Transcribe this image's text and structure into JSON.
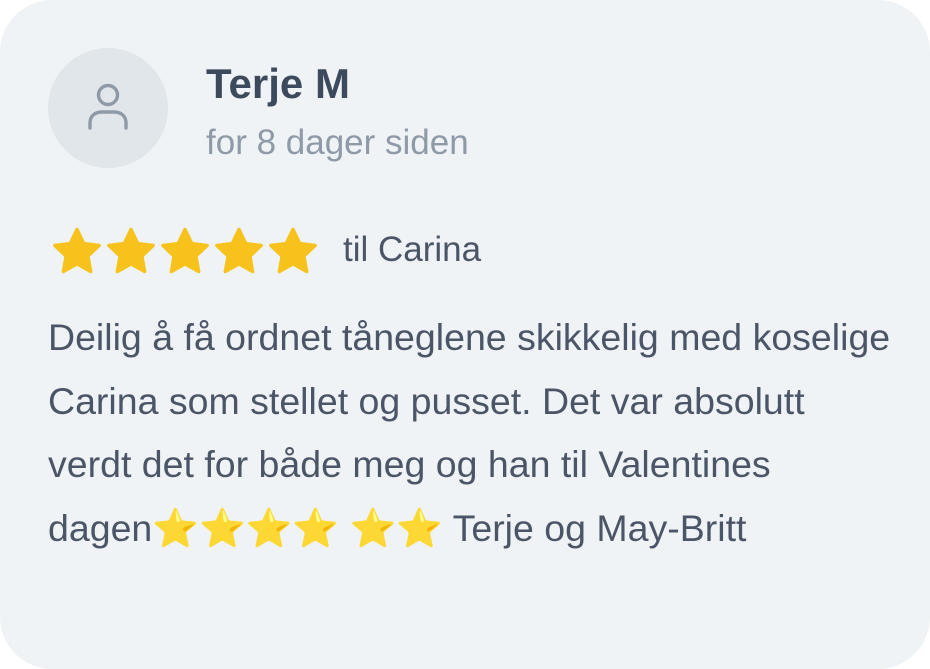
{
  "review": {
    "author": "Terje M",
    "time_ago": "for 8 dager siden",
    "rating": 5,
    "rating_max": 5,
    "recipient": "til Carina",
    "text": "Deilig å få ordnet tåneglene skikkelig med koselige Carina som stellet og pusset. Det var absolutt verdt det for både meg og han til Valentines dagen⭐️⭐️⭐️⭐️ ⭐️⭐️  Terje og May-Britt"
  },
  "icons": {
    "avatar": "user-icon",
    "rating_star": "star-icon"
  },
  "colors": {
    "card_background": "#eff3f5",
    "avatar_background": "#e0e6ea",
    "star": "#f7c21b",
    "author_text": "#3c4a5d",
    "muted_text": "#8e9aa8",
    "body_text": "#4b5568"
  }
}
